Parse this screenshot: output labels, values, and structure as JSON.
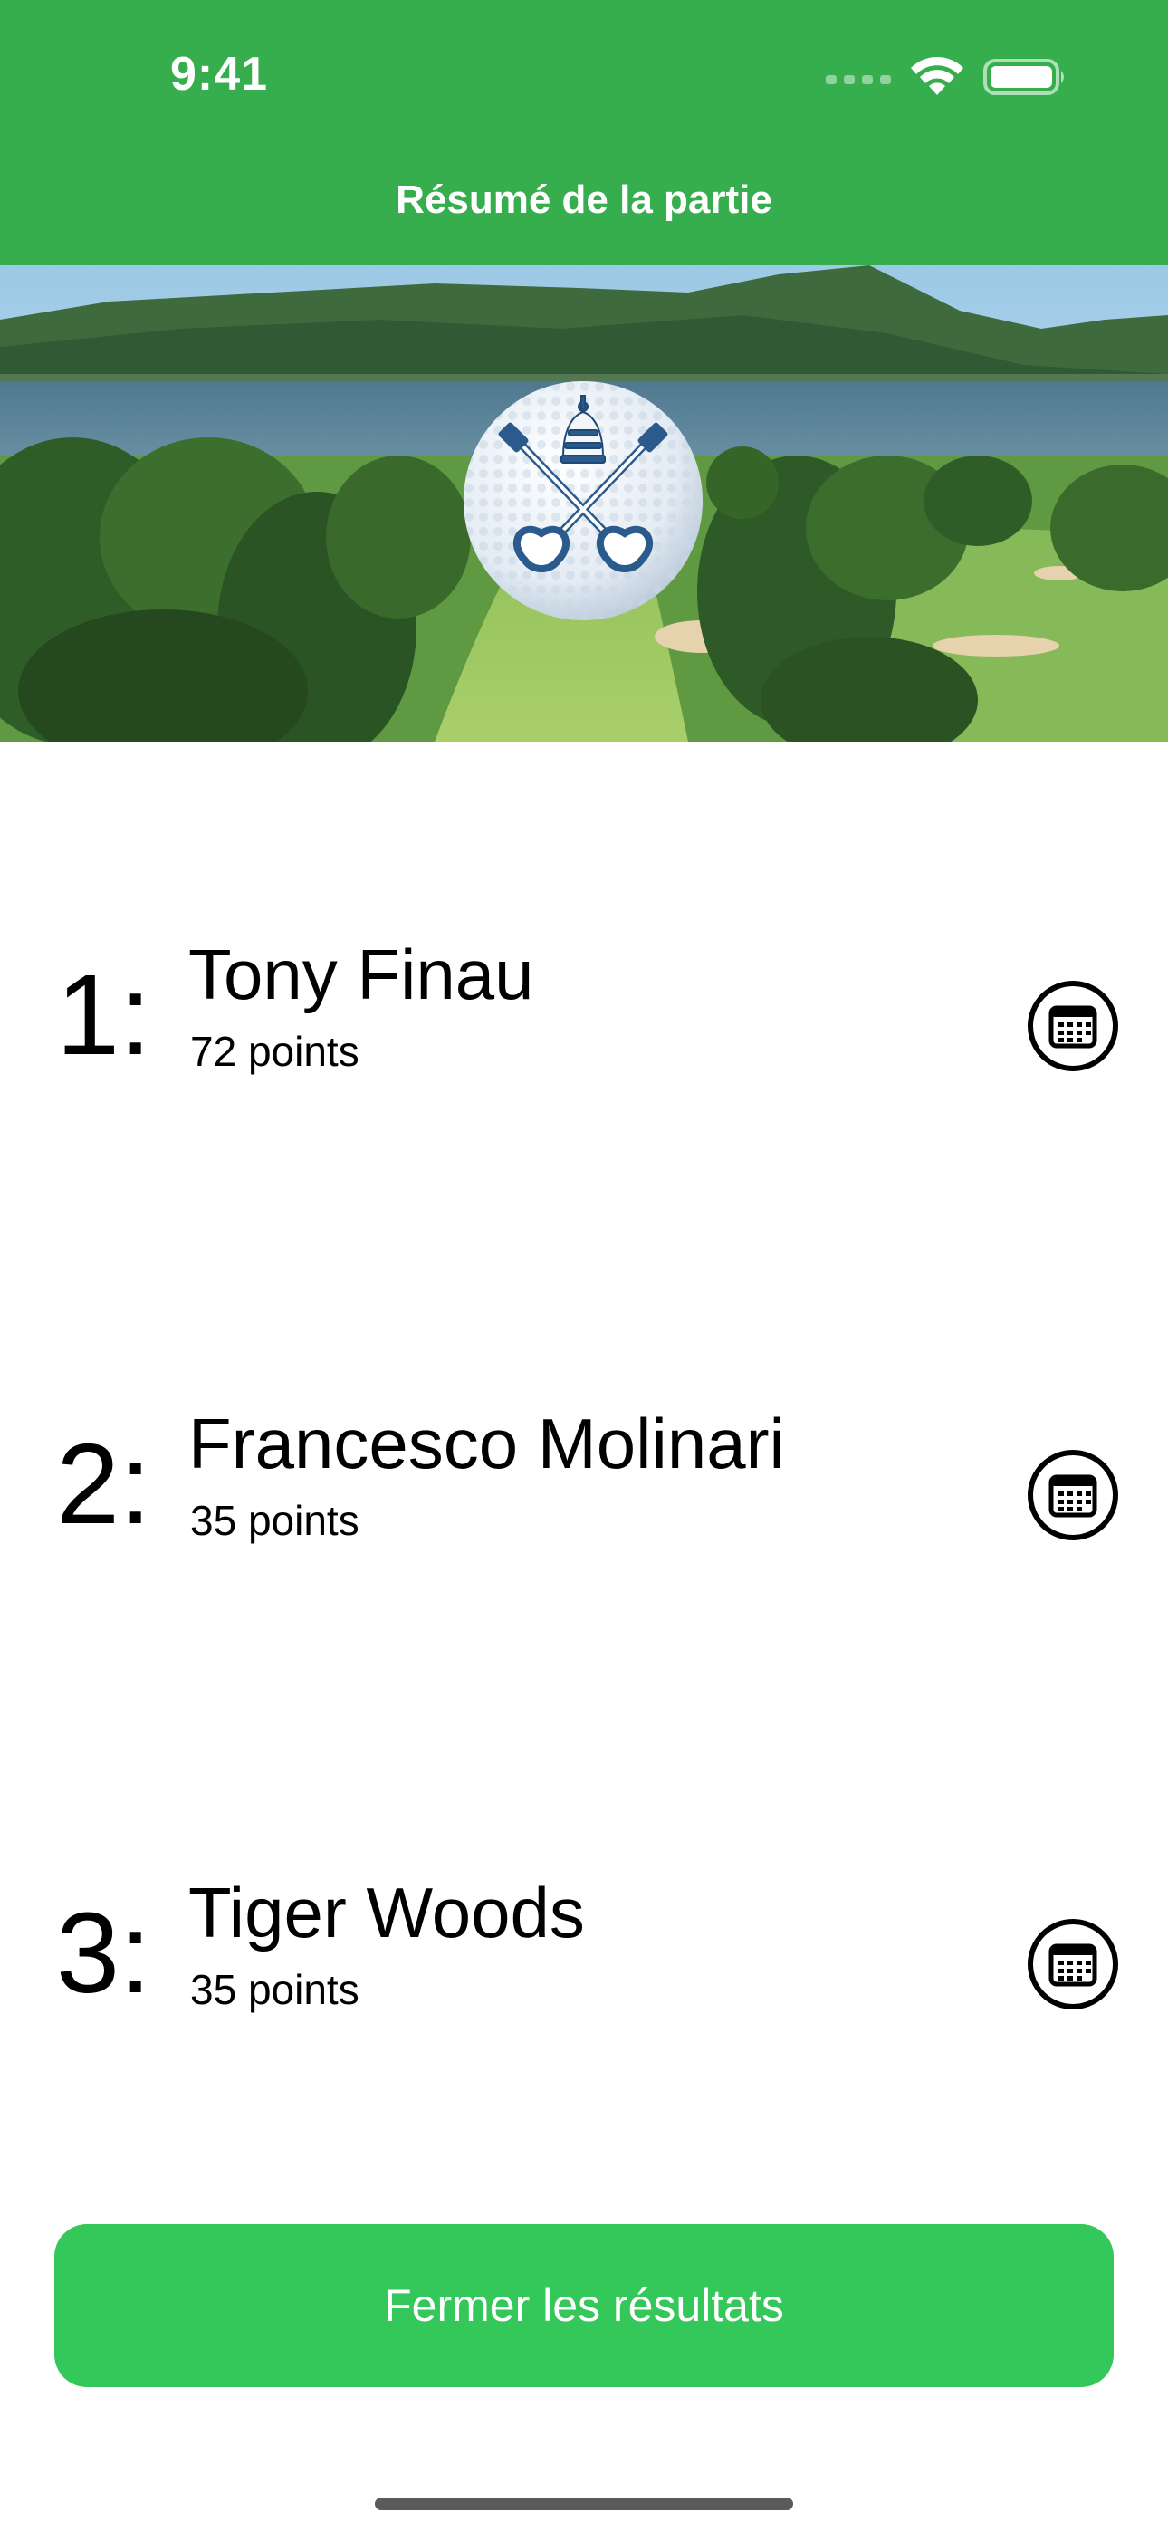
{
  "status_bar": {
    "time": "9:41",
    "icons": [
      "cellular-signal-icon",
      "wifi-icon",
      "battery-icon"
    ]
  },
  "nav": {
    "title": "Résumé de la partie"
  },
  "hero": {
    "image": "golf-course-lake-landscape",
    "emblem": "golf-ball-crossed-keys-emblem"
  },
  "results": [
    {
      "rank": "1:",
      "name": "Tony Finau",
      "points": "72 points",
      "action_icon": "calendar-scorecard-icon"
    },
    {
      "rank": "2:",
      "name": "Francesco Molinari",
      "points": "35 points",
      "action_icon": "calendar-scorecard-icon"
    },
    {
      "rank": "3:",
      "name": "Tiger Woods",
      "points": "35 points",
      "action_icon": "calendar-scorecard-icon"
    }
  ],
  "footer": {
    "close_label": "Fermer les résultats"
  },
  "colors": {
    "header_green": "#37AE4D",
    "button_green": "#34C759",
    "text": "#000000",
    "background": "#FFFFFF"
  }
}
